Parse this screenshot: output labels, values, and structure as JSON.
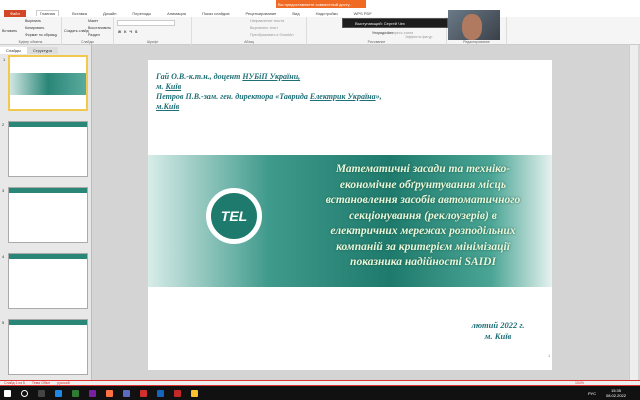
{
  "app": {
    "title": "Microsoft PowerPoint",
    "share_banner": "Вы предоставляете совместный досту...",
    "presenter": "Выступающий: Сергей Чех"
  },
  "tabs": [
    "Файл",
    "Главная",
    "Вставка",
    "Дизайн",
    "Переходы",
    "Анимация",
    "Показ слайдов",
    "Рецензирование",
    "Вид",
    "Надстройки",
    "WPS PDF"
  ],
  "ribbon": {
    "clipboard": {
      "label": "Буфер обмена",
      "paste": "Вставить",
      "cut": "Вырезать",
      "copy": "Копировать",
      "format": "Формат по образцу"
    },
    "slides": {
      "label": "Слайды",
      "new": "Создать слайд",
      "layout": "Макет",
      "reset": "Восстановить",
      "section": "Раздел"
    },
    "font": {
      "label": "Шрифт"
    },
    "paragraph": {
      "label": "Абзац",
      "direction": "Направление текста",
      "align": "Выровнять текст",
      "smartart": "Преобразовать в SmartArt"
    },
    "drawing": {
      "label": "Рисование",
      "arrange": "Упорядочить",
      "styles": "Экспресс-стили",
      "effects": "Эффекты фигур"
    },
    "editing": {
      "label": "Редактирование"
    }
  },
  "panel": {
    "tabs": [
      "Слайды",
      "Структура"
    ],
    "slides": [
      "1",
      "2",
      "3",
      "4",
      "5"
    ]
  },
  "slide": {
    "authors": [
      {
        "pre": "Гай О.В.-к.т.н., доцент ",
        "u": "НУБіП України,"
      },
      {
        "pre": "м. ",
        "u": "Київ"
      },
      {
        "pre": "Петров П.В.-зам. ген. директора «Таврида ",
        "u": "Електрик Україна",
        "post": "»,"
      },
      {
        "pre": "",
        "u": "м.Київ"
      }
    ],
    "title_lines": [
      "Математичні засади та техніко-",
      "економічне обґрунтування  місць",
      "встановлення засобів автоматичного",
      "секціонування (реклоузерів) в",
      "електричних мережах розподільних",
      "компаній за критерієм мінімізації",
      "показника надійності SAIDI"
    ],
    "logo": "TEL",
    "date": "лютий  2022 г.",
    "city": "м. Київ",
    "number": "1"
  },
  "status": {
    "slide": "Слайд 1 из 5",
    "theme": "Тема Office",
    "lang": "русский",
    "zoom": "104%"
  },
  "clock": {
    "time": "15:35",
    "date": "08.02.2022",
    "lang": "РУС"
  }
}
